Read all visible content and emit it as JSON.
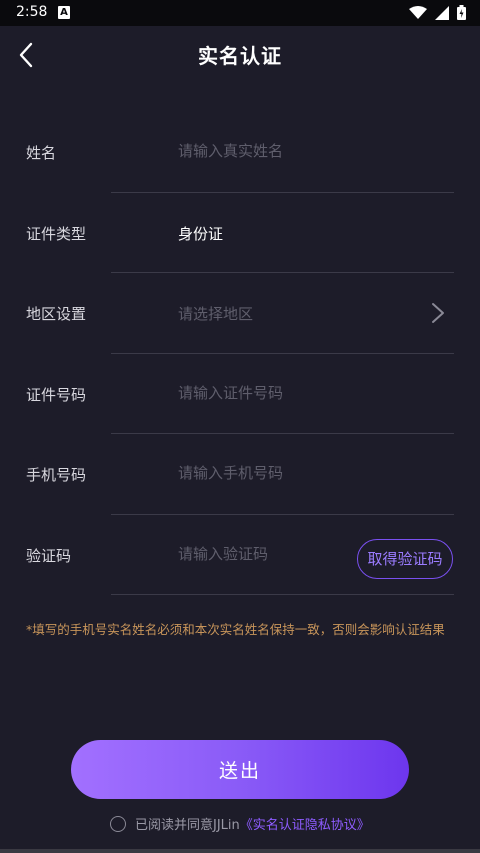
{
  "status_bar": {
    "time": "2:58",
    "notification_icon": "A",
    "icons": [
      "wifi-icon",
      "signal-icon",
      "battery-icon"
    ]
  },
  "header": {
    "back_icon": "chevron-left-icon",
    "title": "实名认证"
  },
  "form": {
    "name": {
      "label": "姓名",
      "placeholder": "请输入真实姓名"
    },
    "id_type": {
      "label": "证件类型",
      "value": "身份证"
    },
    "region": {
      "label": "地区设置",
      "placeholder": "请选择地区",
      "icon": "chevron-right-icon"
    },
    "id_number": {
      "label": "证件号码",
      "placeholder": "请输入证件号码"
    },
    "phone": {
      "label": "手机号码",
      "placeholder": "请输入手机号码"
    },
    "code": {
      "label": "验证码",
      "placeholder": "请输入验证码",
      "button": "取得验证码"
    }
  },
  "notice": "*填写的手机号实名姓名必须和本次实名姓名保持一致，否则会影响认证结果",
  "submit_label": "送出",
  "agreement": {
    "text": "已阅读并同意JJLin",
    "link": "《实名认证隐私协议》"
  },
  "colors": {
    "background": "#1d1c29",
    "accent": "#8a5bf7",
    "notice": "#c8955a",
    "divider": "#3b3a48"
  }
}
